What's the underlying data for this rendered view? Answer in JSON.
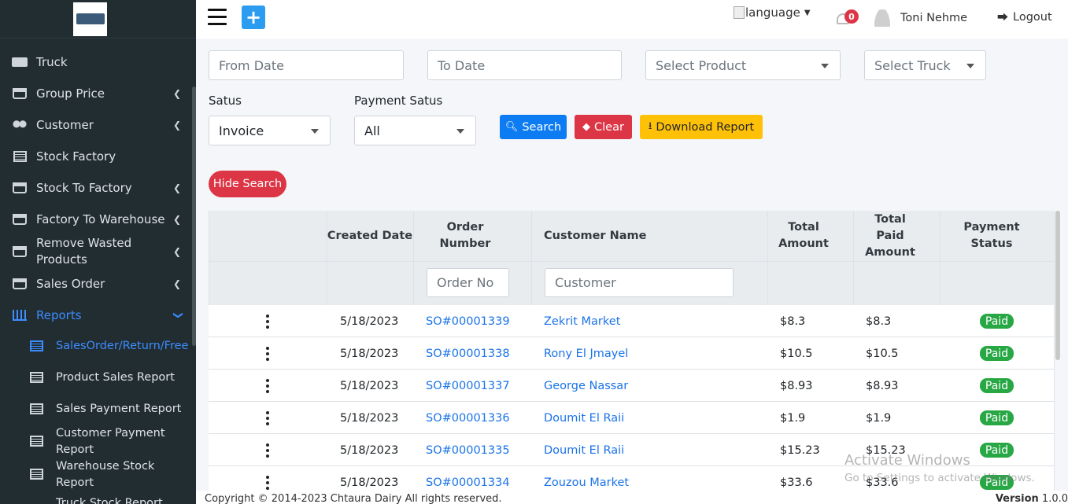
{
  "sidebar": {
    "items": [
      {
        "label": "Truck",
        "icon": "truck-icon",
        "chevron": false
      },
      {
        "label": "Group Price",
        "icon": "cart-icon",
        "chevron": true
      },
      {
        "label": "Customer",
        "icon": "users-icon",
        "chevron": true
      },
      {
        "label": "Stock Factory",
        "icon": "list-icon",
        "chevron": false
      },
      {
        "label": "Stock To Factory",
        "icon": "cart-icon",
        "chevron": true
      },
      {
        "label": "Factory To Warehouse",
        "icon": "cart-icon",
        "chevron": true
      },
      {
        "label": "Remove Wasted Products",
        "icon": "cart-icon",
        "chevron": true
      },
      {
        "label": "Sales Order",
        "icon": "cart-icon",
        "chevron": true
      },
      {
        "label": "Reports",
        "icon": "chart-icon",
        "chevron": true
      }
    ],
    "sub_items": [
      {
        "label": "SalesOrder/Return/Free"
      },
      {
        "label": "Product Sales Report"
      },
      {
        "label": "Sales Payment Report"
      },
      {
        "label": "Customer Payment Report"
      },
      {
        "label": "Warehouse Stock Report"
      },
      {
        "label": "Truck Stock Report"
      }
    ]
  },
  "header": {
    "plus": "+",
    "language": "language",
    "notifications": "0",
    "user_name": "Toni Nehme",
    "logout": "Logout"
  },
  "filters": {
    "from_date": "From Date",
    "to_date": "To Date",
    "product": "Select Product",
    "truck": "Select Truck",
    "status_label": "Satus",
    "status_value": "Invoice",
    "payment_label": "Payment Satus",
    "payment_value": "All",
    "search": "Search",
    "clear": "Clear",
    "download": "Download Report",
    "hide": "Hide Search"
  },
  "table": {
    "headers": [
      "Created Date",
      "Order Number",
      "Customer Name",
      "Total Amount",
      "Total Paid Amount",
      "Payment Status"
    ],
    "order_placeholder": "Order No",
    "customer_placeholder": "Customer",
    "rows": [
      {
        "date": "5/18/2023",
        "order": "SO#00001339",
        "customer": "Zekrit Market",
        "total": "$8.3",
        "paid": "$8.3",
        "status": "Paid"
      },
      {
        "date": "5/18/2023",
        "order": "SO#00001338",
        "customer": "Rony El Jmayel",
        "total": "$10.5",
        "paid": "$10.5",
        "status": "Paid"
      },
      {
        "date": "5/18/2023",
        "order": "SO#00001337",
        "customer": "George Nassar",
        "total": "$8.93",
        "paid": "$8.93",
        "status": "Paid"
      },
      {
        "date": "5/18/2023",
        "order": "SO#00001336",
        "customer": "Doumit El Raii",
        "total": "$1.9",
        "paid": "$1.9",
        "status": "Paid"
      },
      {
        "date": "5/18/2023",
        "order": "SO#00001335",
        "customer": "Doumit El Raii",
        "total": "$15.23",
        "paid": "$15.23",
        "status": "Paid"
      },
      {
        "date": "5/18/2023",
        "order": "SO#00001334",
        "customer": "Zouzou Market",
        "total": "$33.6",
        "paid": "$33.6",
        "status": "Paid"
      }
    ]
  },
  "footer": {
    "copyright": "Copyright © 2014-2023 Chtaura Dairy All rights reserved.",
    "version_label": "Version",
    "version": "1.0.0"
  },
  "watermark": {
    "title": "Activate Windows",
    "subtitle": "Go to Settings to activate Windows."
  },
  "colors": {
    "sidebar_bg": "#222d32",
    "accent": "#3c8dff",
    "paid": "#28a745",
    "danger": "#dc3545",
    "warning": "#ffc107",
    "primary": "#0d7cf2"
  }
}
